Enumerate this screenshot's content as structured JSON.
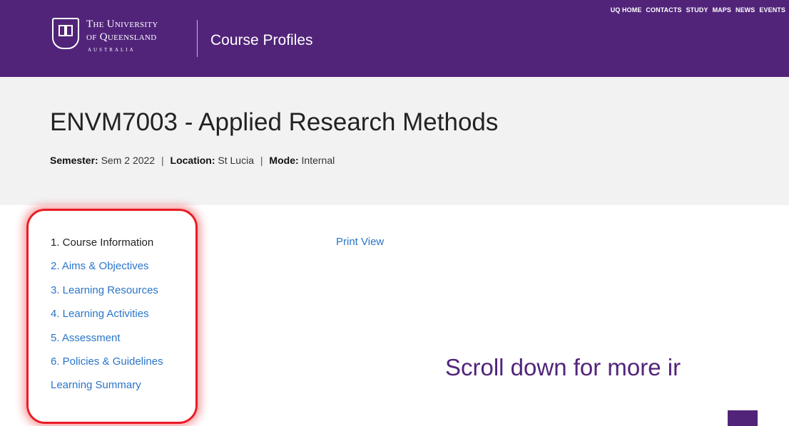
{
  "header": {
    "university_line1": "The University",
    "university_line2": "of Queensland",
    "university_line3": "AUSTRALIA",
    "site_title": "Course Profiles",
    "topnav": [
      "UQ HOME",
      "CONTACTS",
      "STUDY",
      "MAPS",
      "NEWS",
      "EVENTS"
    ]
  },
  "course": {
    "title": "ENVM7003 - Applied Research Methods",
    "semester_label": "Semester:",
    "semester_value": "Sem 2 2022",
    "location_label": "Location:",
    "location_value": "St Lucia",
    "mode_label": "Mode:",
    "mode_value": "Internal",
    "separator": "|"
  },
  "sidenav": {
    "items": [
      {
        "label": "1. Course Information"
      },
      {
        "label": "2. Aims & Objectives"
      },
      {
        "label": "3. Learning Resources"
      },
      {
        "label": "4. Learning Activities"
      },
      {
        "label": "5. Assessment"
      },
      {
        "label": "6. Policies & Guidelines"
      },
      {
        "label": "Learning Summary"
      }
    ]
  },
  "print_view": "Print View",
  "annotation": {
    "scroll_note": "Scroll down for more ir"
  },
  "colors": {
    "brand_purple": "#51247a",
    "link_blue": "#2a75c9",
    "highlight_red": "#ea1c24"
  }
}
